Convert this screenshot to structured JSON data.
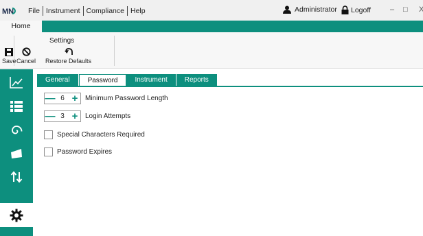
{
  "app": {
    "logo_text": "MN"
  },
  "menu": {
    "items": [
      "File",
      "Instrument",
      "Compliance",
      "Help"
    ]
  },
  "user": {
    "name": "Administrator",
    "logoff_label": "Logoff"
  },
  "window_controls": {
    "minimize": "–",
    "maximize": "□",
    "close": "X"
  },
  "ribbon": {
    "tab": "Home",
    "group_title": "Settings",
    "save_label": "Save",
    "cancel_label": "Cancel",
    "restore_label": "Restore Defaults"
  },
  "sidebar": {
    "items": [
      "chart-icon",
      "list-icon",
      "spiral-icon",
      "folder-icon",
      "sort-arrows-icon",
      "gear-icon"
    ],
    "active": "gear-icon"
  },
  "tabs": {
    "items": [
      "General",
      "Password",
      "Instrument",
      "Reports"
    ],
    "active": "Password"
  },
  "settings": {
    "min_length": {
      "value": "6",
      "label": "Minimum Password Length"
    },
    "login_attempts": {
      "value": "3",
      "label": "Login Attempts"
    },
    "special_chars": {
      "label": "Special Characters Required",
      "checked": false
    },
    "password_expires": {
      "label": "Password Expires",
      "checked": false
    }
  },
  "colors": {
    "accent": "#0d8f7e",
    "title_bg": "#f0f0f0"
  }
}
